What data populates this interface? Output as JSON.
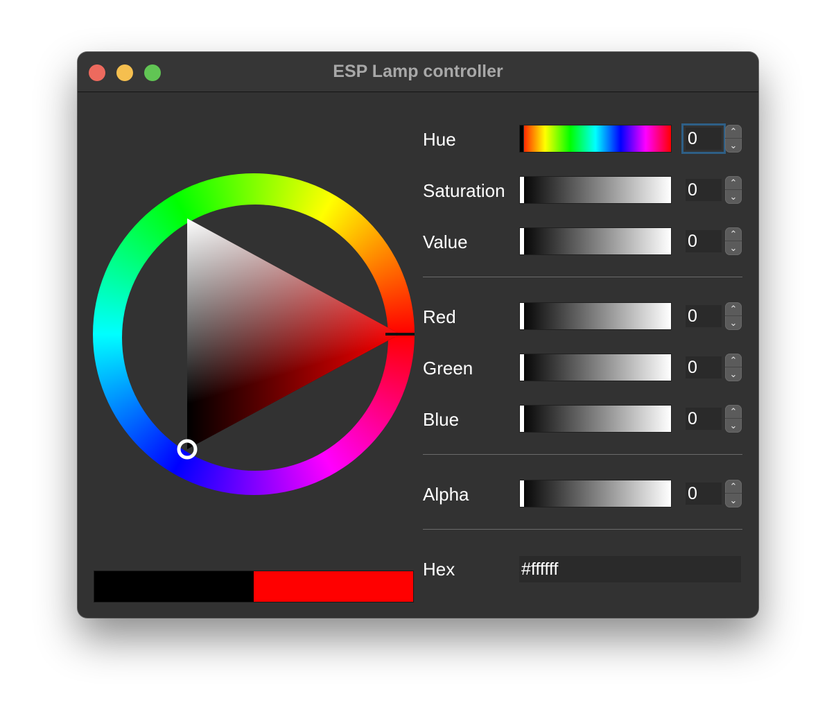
{
  "window": {
    "title": "ESP Lamp controller"
  },
  "colors": {
    "current": "#000000",
    "new": "#ff0000"
  },
  "rows": {
    "hue": {
      "label": "Hue",
      "value": "0"
    },
    "saturation": {
      "label": "Saturation",
      "value": "0"
    },
    "value": {
      "label": "Value",
      "value": "0"
    },
    "red": {
      "label": "Red",
      "value": "0"
    },
    "green": {
      "label": "Green",
      "value": "0"
    },
    "blue": {
      "label": "Blue",
      "value": "0"
    },
    "alpha": {
      "label": "Alpha",
      "value": "0"
    }
  },
  "hex": {
    "label": "Hex",
    "value": "#ffffff"
  },
  "stepper": {
    "up": "⌃",
    "down": "⌄"
  }
}
